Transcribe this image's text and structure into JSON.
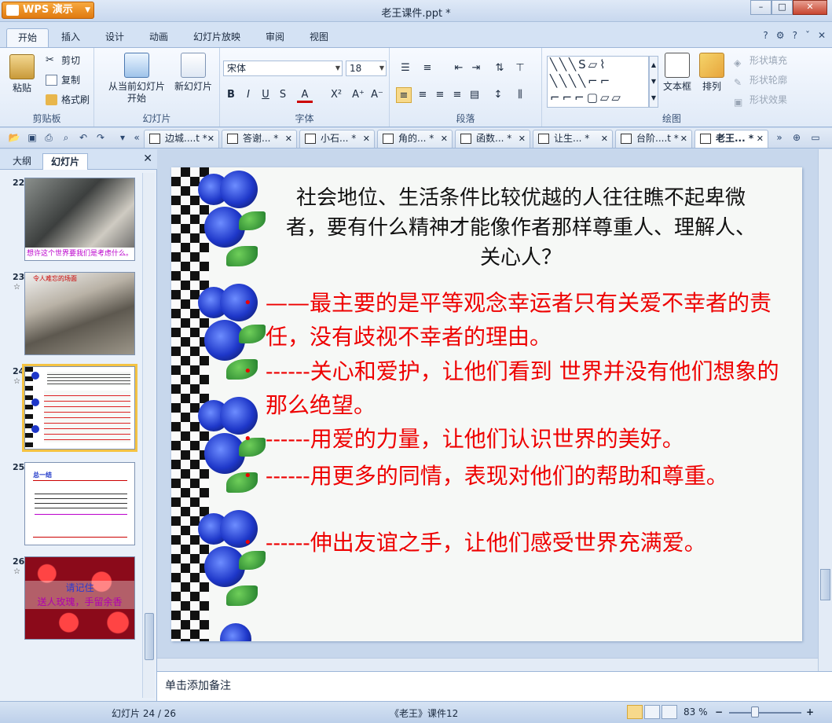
{
  "window": {
    "app_button": "WPS 演示",
    "title": "老王课件.ppt *",
    "min": "–",
    "max": "□",
    "close": "✕"
  },
  "ribbon_tabs": [
    "开始",
    "插入",
    "设计",
    "动画",
    "幻灯片放映",
    "审阅",
    "视图"
  ],
  "ribbon_right": [
    "?",
    "⚙",
    "?",
    "ˇ",
    "✕"
  ],
  "clipboard": {
    "paste": "粘贴",
    "cut": "剪切",
    "copy": "复制",
    "format_painter": "格式刷",
    "label": "剪贴板"
  },
  "slides_group": {
    "from_current": "从当前幻灯片",
    "start": "开始",
    "new_slide": "新幻灯片",
    "label": "幻灯片"
  },
  "font": {
    "name": "宋体",
    "size": "18",
    "label": "字体",
    "bold": "B",
    "italic": "I",
    "underline": "U",
    "shadow": "S",
    "color": "A",
    "super": "X²",
    "grow": "A⁺",
    "shrink": "A⁻"
  },
  "paragraph": {
    "label": "段落"
  },
  "drawing": {
    "textbox": "文本框",
    "arrange": "排列",
    "fill": "形状填充",
    "outline": "形状轮廓",
    "effect": "形状效果",
    "label": "绘图"
  },
  "doc_tabs": [
    "边城....t *",
    "答谢... *",
    "小石... *",
    "角的... *",
    "函数... *",
    "让生... *",
    "台阶....t *",
    "老王... *"
  ],
  "left_panel": {
    "tab_outline": "大纲",
    "tab_slides": "幻灯片",
    "close": "✕",
    "thumbs": [
      {
        "num": "22",
        "caption": "想许这个世界要我们是考虑什么。"
      },
      {
        "num": "23",
        "caption": "令人难忘的场面"
      },
      {
        "num": "24"
      },
      {
        "num": "25",
        "head": "总一结"
      },
      {
        "num": "26",
        "line1": "请记住",
        "line2": "送人玫瑰，手留余香"
      }
    ]
  },
  "slide": {
    "title": "社会地位、生活条件比较优越的人往往瞧不起卑微者，要有什么精神才能像作者那样尊重人、理解人、关心人？",
    "bullets": [
      "——最主要的是平等观念幸运者只有关爱不幸者的责任，没有歧视不幸者的理由。",
      "------关心和爱护，让他们看到 世界并没有他们想象的那么绝望。",
      "------用爱的力量，让他们认识世界的美好。",
      "------用更多的同情，表现对他们的帮助和尊重。",
      "------伸出友谊之手，让他们感受世界充满爱。"
    ],
    "bullet_dot": "•"
  },
  "notes_placeholder": "单击添加备注",
  "status": {
    "slide_count": "幻灯片 24 / 26",
    "template": "《老王》课件12",
    "zoom": "83 %",
    "zoom_minus": "−",
    "zoom_plus": "+"
  },
  "colors": {
    "accent": "#e07a10",
    "bullet_red": "#e00000",
    "rose_blue": "#1e37c9",
    "selected_outline": "#f4c343"
  }
}
